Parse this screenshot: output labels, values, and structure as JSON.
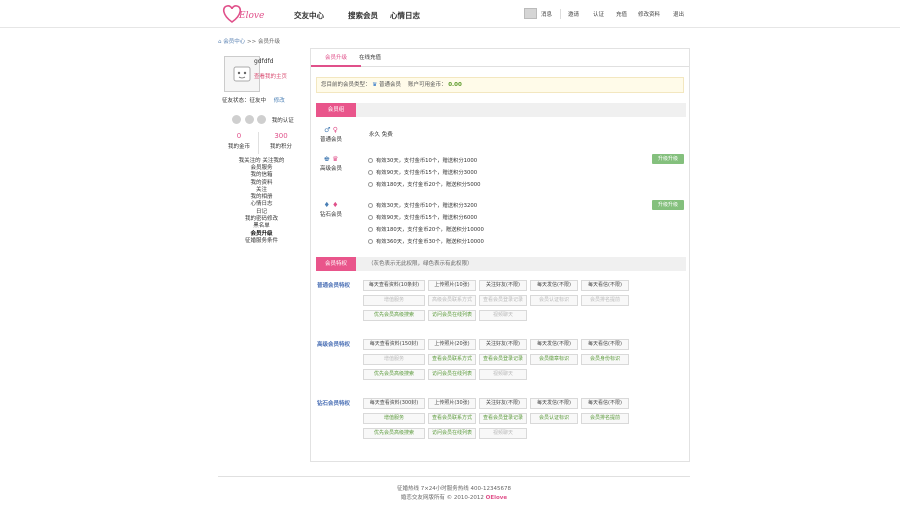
{
  "header": {
    "logo_text": "Elove",
    "nav": [
      "交友中心",
      "搜索会员",
      "心情日志"
    ],
    "right": [
      "消息",
      "邀请",
      "认证",
      "充值",
      "修改资料",
      "退出"
    ]
  },
  "breadcrumb": {
    "home": "会员中心",
    "sep": ">>",
    "current": "会员升级"
  },
  "profile": {
    "username": "gdfdfd",
    "upgrade_link": "查看我的主页",
    "status_label": "征友状态：征友中",
    "status_action": "修改",
    "auth_text": "我的认证",
    "coins_value": "0",
    "coins_label": "我的金币",
    "points_value": "300",
    "points_label": "我的积分",
    "links": "我关注的 关注我的"
  },
  "menu": [
    "会员服务",
    "我的信箱",
    "我的资料",
    "关注",
    "我的相册",
    "心情日志",
    "日记",
    "我的密码修改",
    "黑名单",
    "会员升级",
    "征婚服务条件"
  ],
  "tabs": [
    "会员升级",
    "在线充值"
  ],
  "notice": {
    "prefix": "您目前的会员类型：",
    "type": "普通会员",
    "balance_label": "账户可用金币：",
    "balance_value": "0.00"
  },
  "section_levels": {
    "tag": "会员组"
  },
  "levels": {
    "normal": {
      "name": "普通会员",
      "desc": "永久 免费"
    },
    "vip": {
      "name": "高级会员",
      "options": [
        "有效30天，支付金币10个，赠送积分1000",
        "有效90天，支付金币15个，赠送积分3000",
        "有效180天，支付金币20个，赠送积分5000"
      ],
      "button": "升级升级"
    },
    "diamond": {
      "name": "钻石会员",
      "options": [
        "有效30天，支付金币10个，赠送积分3200",
        "有效90天，支付金币15个，赠送积分6000",
        "有效180天，支付金币20个，赠送积分10000",
        "有效360天，支付金币30个，赠送积分10000"
      ],
      "button": "升级升级"
    }
  },
  "section_privileges": {
    "tag": "会员特权",
    "desc": "（灰色表示无此权限，绿色表示有此权限）"
  },
  "privileges": {
    "normal": {
      "title": "普通会员特权",
      "rows": [
        [
          {
            "t": "每天查看资料(10条封)",
            "s": "n"
          },
          {
            "t": "上传照片(10张)",
            "s": "n"
          },
          {
            "t": "关注好友(不限)",
            "s": "n"
          },
          {
            "t": "每天发信(不限)",
            "s": "n"
          },
          {
            "t": "每天看信(不限)",
            "s": "n"
          }
        ],
        [
          {
            "t": "增值服务",
            "s": "d"
          },
          {
            "t": "高级会员联系方式",
            "s": "d"
          },
          {
            "t": "查看会员登录记录",
            "s": "d"
          },
          {
            "t": "会员认证标识",
            "s": "d"
          },
          {
            "t": "会员排名提前",
            "s": "d"
          }
        ],
        [
          {
            "t": "优先会员高级搜索",
            "s": "g"
          },
          {
            "t": "访问会员在线列表",
            "s": "g"
          },
          {
            "t": "视频聊天",
            "s": "d"
          }
        ]
      ]
    },
    "vip": {
      "title": "高级会员特权",
      "rows": [
        [
          {
            "t": "每天查看资料(150封)",
            "s": "n"
          },
          {
            "t": "上传照片(20张)",
            "s": "n"
          },
          {
            "t": "关注好友(不限)",
            "s": "n"
          },
          {
            "t": "每天发信(不限)",
            "s": "n"
          },
          {
            "t": "每天看信(不限)",
            "s": "n"
          }
        ],
        [
          {
            "t": "增值服务",
            "s": "d"
          },
          {
            "t": "查看会员联系方式",
            "s": "g"
          },
          {
            "t": "查看会员登录记录",
            "s": "g"
          },
          {
            "t": "会员徽章标识",
            "s": "g"
          },
          {
            "t": "会员身份标识",
            "s": "g"
          }
        ],
        [
          {
            "t": "优先会员高级搜索",
            "s": "g"
          },
          {
            "t": "访问会员在线列表",
            "s": "g"
          },
          {
            "t": "视频聊天",
            "s": "d"
          }
        ]
      ]
    },
    "diamond": {
      "title": "钻石会员特权",
      "rows": [
        [
          {
            "t": "每天查看资料(300封)",
            "s": "n"
          },
          {
            "t": "上传照片(30张)",
            "s": "n"
          },
          {
            "t": "关注好友(不限)",
            "s": "n"
          },
          {
            "t": "每天发信(不限)",
            "s": "n"
          },
          {
            "t": "每天看信(不限)",
            "s": "n"
          }
        ],
        [
          {
            "t": "增值服务",
            "s": "g"
          },
          {
            "t": "查看会员联系方式",
            "s": "g"
          },
          {
            "t": "查看会员登录记录",
            "s": "g"
          },
          {
            "t": "会员认证标识",
            "s": "g"
          },
          {
            "t": "会员排名提前",
            "s": "g"
          }
        ],
        [
          {
            "t": "优先会员高级搜索",
            "s": "g"
          },
          {
            "t": "访问会员在线列表",
            "s": "g"
          },
          {
            "t": "视频聊天",
            "s": "d"
          }
        ]
      ]
    }
  },
  "footer": {
    "line1": "征婚热线    7×24小时服务热线 400-12345678",
    "line2_prefix": "婚恋交友网版所有 © 2010-2012",
    "brand": "OElove"
  },
  "colors": {
    "accent": "#e9558b",
    "green": "#84c07d",
    "link": "#4a7fb5"
  }
}
